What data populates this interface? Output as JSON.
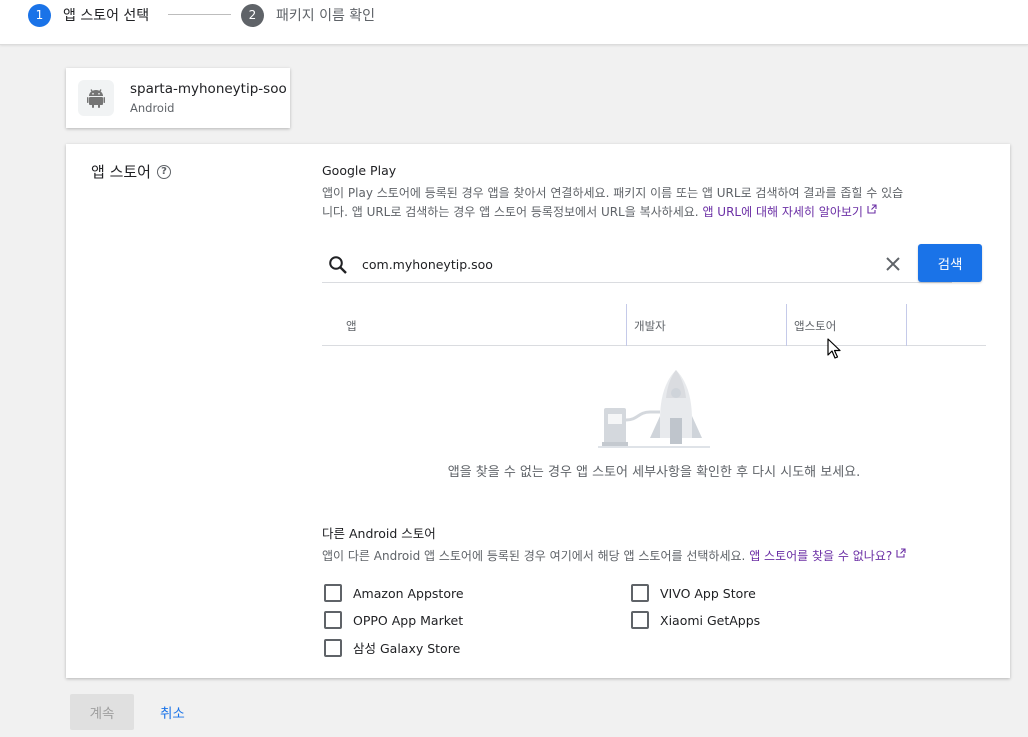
{
  "stepper": {
    "step1": {
      "number": "1",
      "label": "앱 스토어 선택"
    },
    "step2": {
      "number": "2",
      "label": "패키지 이름 확인"
    }
  },
  "app": {
    "name": "sparta-myhoneytip-soo",
    "platform": "Android",
    "icon": "android-icon"
  },
  "section": {
    "title": "앱 스토어",
    "help_icon": "help-icon"
  },
  "google_play": {
    "title": "Google Play",
    "description_line1": "앱이 Play 스토어에 등록된 경우 앱을 찾아서 연결하세요. 패키지 이름 또는 앱 URL로 검색하여 결과를 좁힐 수 있습",
    "description_line2": "니다. 앱 URL로 검색하는 경우 앱 스토어 등록정보에서 URL을 복사하세요. ",
    "link_text": "앱 URL에 대해 자세히 알아보기"
  },
  "search": {
    "value": "com.myhoneytip.soo",
    "button_label": "검색"
  },
  "table": {
    "columns": [
      "앱",
      "개발자",
      "앱스토어"
    ]
  },
  "empty_state": {
    "message": "앱을 찾을 수 없는 경우 앱 스토어 세부사항을 확인한 후 다시 시도해 보세요."
  },
  "other_stores": {
    "title": "다른 Android 스토어",
    "description": "앱이 다른 Android 앱 스토어에 등록된 경우 여기에서 해당 앱 스토어를 선택하세요. ",
    "link_text": "앱 스토어를 찾을 수 없나요?",
    "stores": [
      {
        "label": "Amazon Appstore",
        "checked": false
      },
      {
        "label": "OPPO App Market",
        "checked": false
      },
      {
        "label": "삼성 Galaxy Store",
        "checked": false
      },
      {
        "label": "VIVO App Store",
        "checked": false
      },
      {
        "label": "Xiaomi GetApps",
        "checked": false
      }
    ]
  },
  "footer": {
    "continue_label": "계속",
    "cancel_label": "취소"
  },
  "colors": {
    "primary": "#1a73e8",
    "link_purple": "#6b2fa5",
    "background": "#f1f1f1"
  }
}
